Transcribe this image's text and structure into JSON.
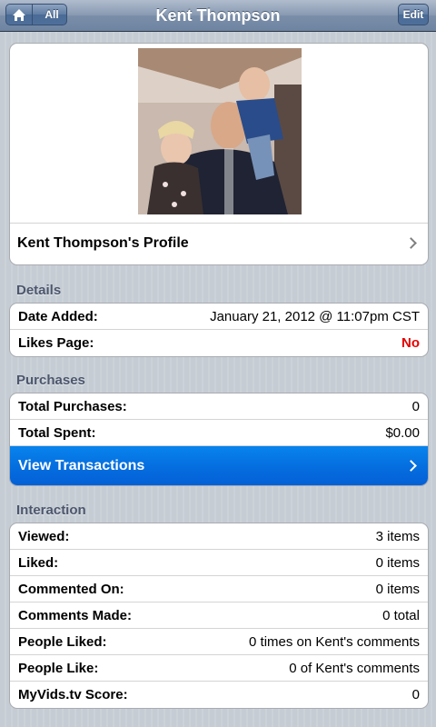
{
  "nav": {
    "title": "Kent Thompson",
    "back_label": "All",
    "edit_label": "Edit",
    "home_icon": "home-icon"
  },
  "profile": {
    "photo_desc": "profile-photo",
    "link_label": "Kent Thompson's Profile"
  },
  "details": {
    "header": "Details",
    "rows": [
      {
        "label": "Date Added:",
        "value": "January 21, 2012 @ 11:07pm CST"
      },
      {
        "label": "Likes Page:",
        "value": "No"
      }
    ]
  },
  "purchases": {
    "header": "Purchases",
    "rows": [
      {
        "label": "Total Purchases:",
        "value": "0"
      },
      {
        "label": "Total Spent:",
        "value": "$0.00"
      }
    ],
    "view_transactions": "View Transactions"
  },
  "interaction": {
    "header": "Interaction",
    "rows": [
      {
        "label": "Viewed:",
        "value": "3 items"
      },
      {
        "label": "Liked:",
        "value": "0 items"
      },
      {
        "label": "Commented On:",
        "value": "0 items"
      },
      {
        "label": "Comments Made:",
        "value": "0 total"
      },
      {
        "label": "People Liked:",
        "value": "0 times on Kent's comments"
      },
      {
        "label": "People Like:",
        "value": "0 of Kent's comments"
      },
      {
        "label": "MyVids.tv Score:",
        "value": "0"
      }
    ]
  },
  "colors": {
    "accent_blue": "#056fe0",
    "negative_red": "#e60000",
    "navbar": "#6d84a2"
  }
}
